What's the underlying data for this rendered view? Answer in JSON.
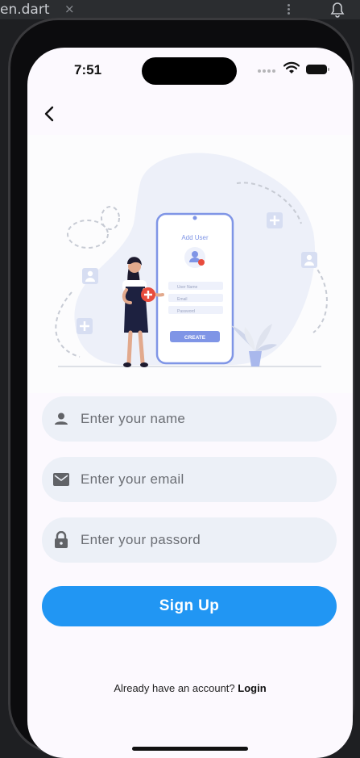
{
  "ide": {
    "tab_label": "en.dart",
    "tab_close": "×"
  },
  "status_bar": {
    "time": "7:51"
  },
  "icons": {
    "back": "chevron-left-icon",
    "name": "person-icon",
    "email": "mail-icon",
    "password": "lock-icon"
  },
  "illustration": {
    "title": "Add User",
    "field1": "User Name",
    "field2": "Email",
    "field3": "Password",
    "button": "CREATE"
  },
  "form": {
    "name_placeholder": "Enter your name",
    "email_placeholder": "Enter your email",
    "password_placeholder": "Enter your passord",
    "submit_label": "Sign Up"
  },
  "footer": {
    "prompt": "Already have an account? ",
    "login_label": "Login"
  },
  "colors": {
    "primary": "#2196f3",
    "field_bg": "#ecf0f7",
    "screen_bg": "#fcf9fe",
    "illustration_accent": "#7f95e6"
  }
}
